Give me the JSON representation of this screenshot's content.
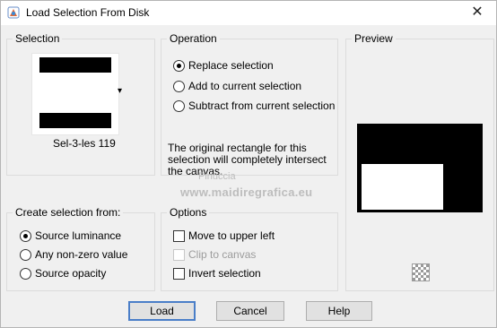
{
  "window": {
    "title": "Load Selection From Disk",
    "close_glyph": "✕"
  },
  "selection": {
    "group_label": "Selection",
    "file_name": "Sel-3-les 119",
    "dropdown_glyph": "▾"
  },
  "operation": {
    "group_label": "Operation",
    "options": [
      {
        "label": "Replace selection",
        "selected": true
      },
      {
        "label": "Add to current selection",
        "selected": false
      },
      {
        "label": "Subtract from current selection",
        "selected": false
      }
    ],
    "notice": "The original rectangle for this selection will completely intersect the canvas."
  },
  "preview": {
    "group_label": "Preview"
  },
  "create_from": {
    "group_label": "Create selection from:",
    "options": [
      {
        "label": "Source luminance",
        "selected": true
      },
      {
        "label": "Any non-zero value",
        "selected": false
      },
      {
        "label": "Source opacity",
        "selected": false
      }
    ]
  },
  "options": {
    "group_label": "Options",
    "items": [
      {
        "label": "Move to upper left",
        "checked": false,
        "enabled": true
      },
      {
        "label": "Clip to canvas",
        "checked": false,
        "enabled": false
      },
      {
        "label": "Invert selection",
        "checked": false,
        "enabled": true
      }
    ]
  },
  "buttons": {
    "load": "Load",
    "cancel": "Cancel",
    "help": "Help"
  },
  "watermark": {
    "brand": "Pinuccia",
    "url": "www.maidiregrafica.eu"
  }
}
